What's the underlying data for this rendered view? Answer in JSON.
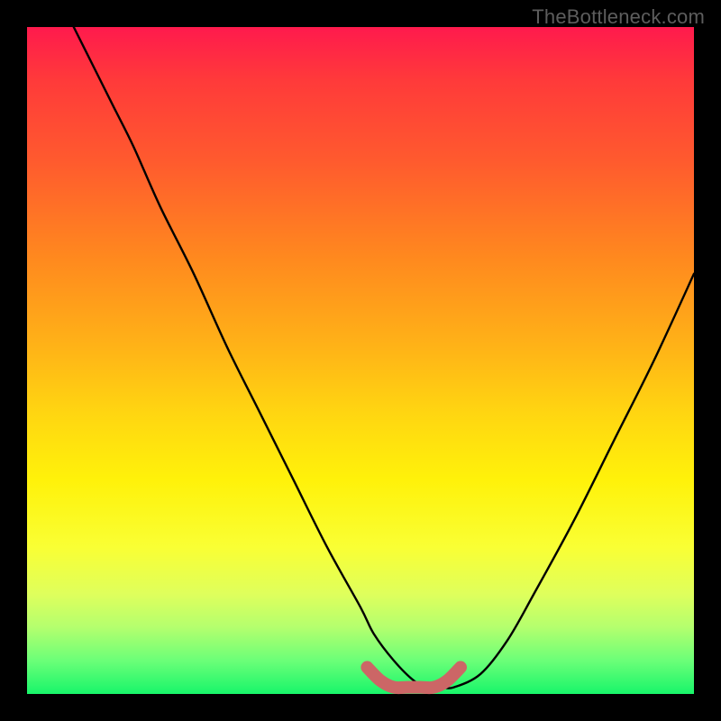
{
  "watermark": "TheBottleneck.com",
  "chart_data": {
    "type": "line",
    "title": "",
    "xlabel": "",
    "ylabel": "",
    "xlim": [
      0,
      100
    ],
    "ylim": [
      0,
      100
    ],
    "grid": false,
    "legend": false,
    "background_gradient": {
      "top": "#ff1a4d",
      "mid": "#ffd611",
      "bottom": "#18f56a"
    },
    "series": [
      {
        "name": "bottleneck-curve",
        "color": "#000000",
        "x": [
          7,
          10,
          13,
          16,
          20,
          25,
          30,
          35,
          40,
          45,
          50,
          52,
          55,
          58,
          60,
          62,
          64,
          68,
          72,
          76,
          82,
          88,
          94,
          100
        ],
        "y": [
          100,
          94,
          88,
          82,
          73,
          63,
          52,
          42,
          32,
          22,
          13,
          9,
          5,
          2,
          1,
          1,
          1,
          3,
          8,
          15,
          26,
          38,
          50,
          63
        ]
      },
      {
        "name": "sweet-spot-band",
        "color": "#cc6666",
        "style": "thick",
        "x": [
          51,
          53,
          55,
          57,
          59,
          61,
          63,
          65
        ],
        "y": [
          4,
          2,
          1,
          1,
          1,
          1,
          2,
          4
        ]
      }
    ]
  }
}
